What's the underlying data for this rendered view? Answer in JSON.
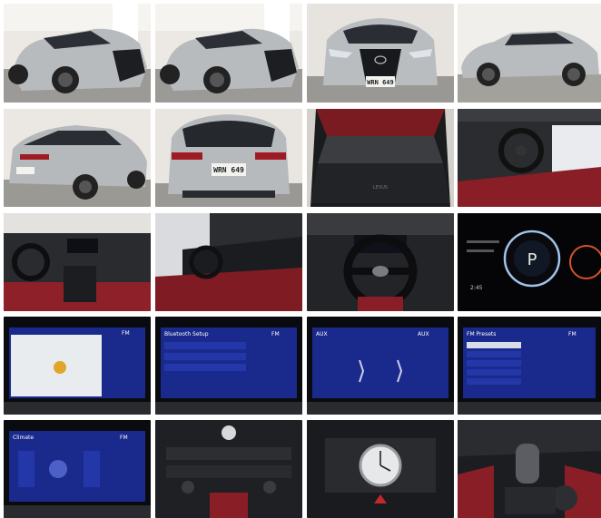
{
  "gallery": {
    "photos": [
      {
        "subject": "front three-quarter exterior"
      },
      {
        "subject": "front three-quarter exterior"
      },
      {
        "subject": "front exterior",
        "plate": "WRN 649"
      },
      {
        "subject": "side profile exterior"
      },
      {
        "subject": "rear three-quarter exterior"
      },
      {
        "subject": "rear exterior",
        "plate": "WRN 649"
      },
      {
        "subject": "cargo area"
      },
      {
        "subject": "driver cockpit"
      },
      {
        "subject": "dashboard"
      },
      {
        "subject": "passenger side dashboard"
      },
      {
        "subject": "steering wheel"
      },
      {
        "subject": "instrument cluster",
        "gauge": "P",
        "time": "2:45"
      },
      {
        "subject": "navigation screen",
        "band": "FM"
      },
      {
        "subject": "bluetooth setup screen",
        "title": "Bluetooth Setup",
        "band": "FM"
      },
      {
        "subject": "audio aux screen",
        "title": "AUX",
        "band": "AUX"
      },
      {
        "subject": "fm presets screen",
        "title": "FM Presets",
        "band": "FM"
      },
      {
        "subject": "climate screen",
        "title": "Climate",
        "band": "FM"
      },
      {
        "subject": "center console controls"
      },
      {
        "subject": "analog clock"
      },
      {
        "subject": "gear shifter"
      }
    ],
    "colors": {
      "silver": "#b9bcbf",
      "interior_red": "#8a1e26",
      "screen_blue": "#1a2a8c",
      "showroom": "#e8e6e2"
    }
  }
}
